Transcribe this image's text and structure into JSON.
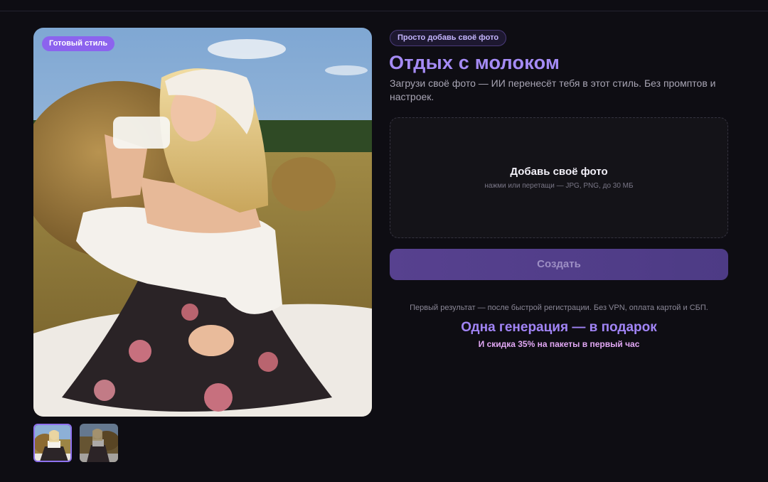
{
  "colors": {
    "background": "#0e0d13",
    "accent": "#8c63ee",
    "title": "#a58bf5",
    "button": "#57418f",
    "discount": "#e2a8f5"
  },
  "hero": {
    "badge": "Готовый стиль",
    "image": "woman-drinking-milk-in-hay-field",
    "thumbnails": [
      {
        "image": "woman-drinking-milk",
        "selected": true
      },
      {
        "image": "woman-sitting-by-haystack",
        "selected": false
      }
    ]
  },
  "panel": {
    "eyebrow": "Просто добавь своё фото",
    "title": "Отдых с молоком",
    "subtitle": "Загрузи своё фото — ИИ перенесёт тебя в этот стиль. Без промптов и настроек.",
    "dropzone": {
      "title": "Добавь своё фото",
      "hint": "нажми или перетащи — JPG, PNG, до 30 МБ"
    },
    "create_label": "Создать",
    "note": "Первый результат — после быстрой регистрации. Без VPN, оплата картой и СБП.",
    "gift": "Одна генерация — в подарок",
    "discount": "И скидка 35% на пакеты в первый час"
  }
}
